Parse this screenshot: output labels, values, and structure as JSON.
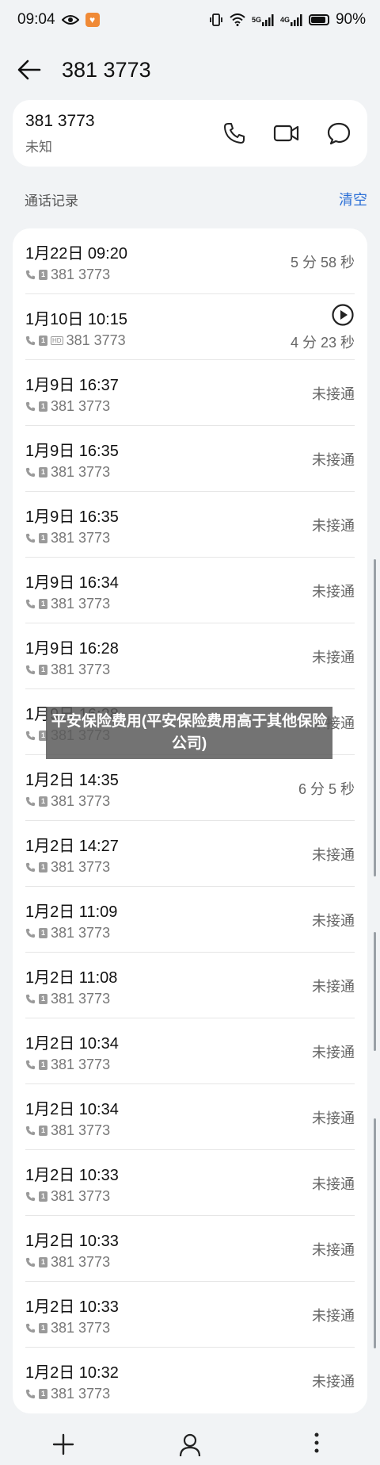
{
  "status_bar": {
    "time": "09:04",
    "network_5g": "5G",
    "network_4g": "4G",
    "battery_percent": "90%",
    "battery_level": 0.9
  },
  "header": {
    "title": "381 3773"
  },
  "contact": {
    "number": "381 3773",
    "label": "未知"
  },
  "section": {
    "title": "通话记录",
    "clear_label": "清空"
  },
  "records": [
    {
      "time": "1月22日 09:20",
      "number": "381 3773",
      "status": "5 分 58 秒",
      "hd": false,
      "play": false
    },
    {
      "time": "1月10日 10:15",
      "number": "381 3773",
      "status": "4 分 23 秒",
      "hd": true,
      "play": true
    },
    {
      "time": "1月9日 16:37",
      "number": "381 3773",
      "status": "未接通",
      "hd": false,
      "play": false
    },
    {
      "time": "1月9日 16:35",
      "number": "381 3773",
      "status": "未接通",
      "hd": false,
      "play": false
    },
    {
      "time": "1月9日 16:35",
      "number": "381 3773",
      "status": "未接通",
      "hd": false,
      "play": false
    },
    {
      "time": "1月9日 16:34",
      "number": "381 3773",
      "status": "未接通",
      "hd": false,
      "play": false
    },
    {
      "time": "1月9日 16:28",
      "number": "381 3773",
      "status": "未接通",
      "hd": false,
      "play": false
    },
    {
      "time": "1月9日 16:28",
      "number": "381 3773",
      "status": "未接通",
      "hd": false,
      "play": false
    },
    {
      "time": "1月2日 14:35",
      "number": "381 3773",
      "status": "6 分 5 秒",
      "hd": false,
      "play": false
    },
    {
      "time": "1月2日 14:27",
      "number": "381 3773",
      "status": "未接通",
      "hd": false,
      "play": false
    },
    {
      "time": "1月2日 11:09",
      "number": "381 3773",
      "status": "未接通",
      "hd": false,
      "play": false
    },
    {
      "time": "1月2日 11:08",
      "number": "381 3773",
      "status": "未接通",
      "hd": false,
      "play": false
    },
    {
      "time": "1月2日 10:34",
      "number": "381 3773",
      "status": "未接通",
      "hd": false,
      "play": false
    },
    {
      "time": "1月2日 10:34",
      "number": "381 3773",
      "status": "未接通",
      "hd": false,
      "play": false
    },
    {
      "time": "1月2日 10:33",
      "number": "381 3773",
      "status": "未接通",
      "hd": false,
      "play": false
    },
    {
      "time": "1月2日 10:33",
      "number": "381 3773",
      "status": "未接通",
      "hd": false,
      "play": false
    },
    {
      "time": "1月2日 10:33",
      "number": "381 3773",
      "status": "未接通",
      "hd": false,
      "play": false
    },
    {
      "time": "1月2日 10:32",
      "number": "381 3773",
      "status": "未接通",
      "hd": false,
      "play": false
    }
  ],
  "overlay": {
    "text": "平安保险费用(平安保险费用高于其他保险公司)"
  },
  "icons": {
    "back": "arrow-left-icon",
    "call": "phone-icon",
    "video": "video-camera-icon",
    "message": "message-bubble-icon",
    "add": "plus-icon",
    "contact": "person-icon",
    "more": "more-vertical-icon"
  },
  "colors": {
    "accent": "#2b6fd6",
    "background": "#f1f3f5",
    "card": "#ffffff"
  }
}
